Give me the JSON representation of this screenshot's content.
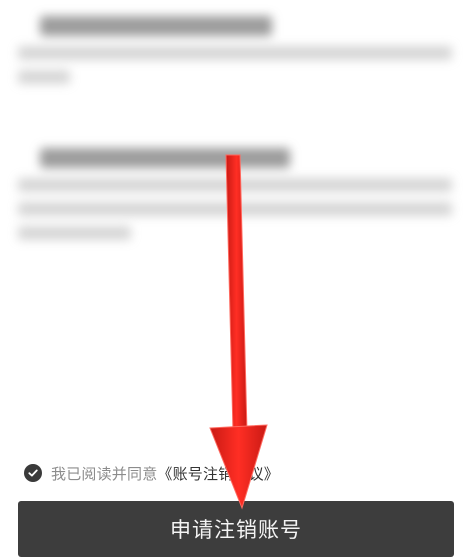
{
  "agreement": {
    "prefix": "我已阅读并同意",
    "link": "《账号注销协议》"
  },
  "apply_button": {
    "label": "申请注销账号"
  },
  "colors": {
    "button_bg": "#3d3d3d",
    "arrow": "#e8241c"
  },
  "icons": {
    "check": "check-circle-icon",
    "arrow": "red-down-arrow-annotation"
  }
}
